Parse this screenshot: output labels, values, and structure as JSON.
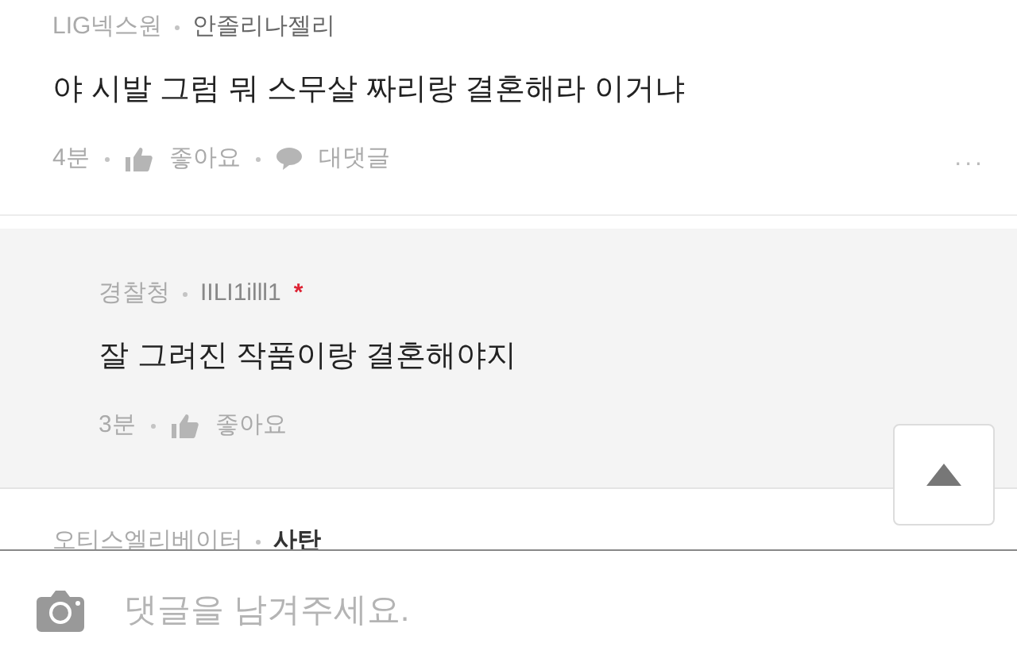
{
  "comments": [
    {
      "kind": "comment",
      "company": "LIG넥스원",
      "nickname": "안졸리나젤리",
      "text": "야 시발 그럼 뭐 스무살 짜리랑 결혼해라 이거냐",
      "time": "4분",
      "like": "좋아요",
      "reply": "대댓글",
      "more": "..."
    },
    {
      "kind": "reply",
      "company": "경찰청",
      "nickname": "IILI1illl1",
      "author_mark": "*",
      "text": "잘 그려진 작품이랑 결혼해야지",
      "time": "3분",
      "like": "좋아요"
    },
    {
      "kind": "comment",
      "company": "오티스엘리베이터",
      "nickname": "사탄"
    }
  ],
  "comment_input": {
    "placeholder": "댓글을 남겨주세요."
  }
}
